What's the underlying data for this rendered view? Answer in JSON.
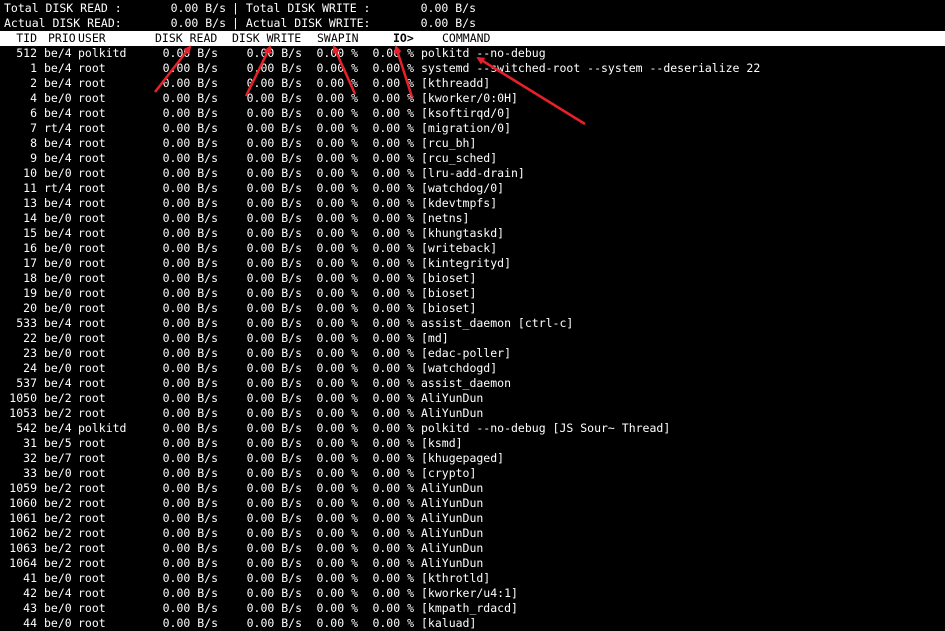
{
  "summary": {
    "total_read_label": "Total DISK READ :",
    "total_read_value": "0.00 B/s",
    "total_write_label": "| Total DISK WRITE :",
    "total_write_value": "0.00 B/s",
    "actual_read_label": "Actual DISK READ:",
    "actual_read_value": "0.00 B/s",
    "actual_write_label": "| Actual DISK WRITE:",
    "actual_write_value": "0.00 B/s"
  },
  "columns": {
    "tid": "TID",
    "prio": "PRIO",
    "user": "USER",
    "disk_read": "DISK READ",
    "disk_write": "DISK WRITE",
    "swapin": "SWAPIN",
    "io": "IO>",
    "command": "COMMAND"
  },
  "rows": [
    {
      "tid": "512",
      "prio": "be/4",
      "user": "polkitd",
      "read": "0.00 B/s",
      "write": "0.00 B/s",
      "swapin": "0.00 %",
      "io": "0.00 %",
      "command": "polkitd --no-debug"
    },
    {
      "tid": "1",
      "prio": "be/4",
      "user": "root",
      "read": "0.00 B/s",
      "write": "0.00 B/s",
      "swapin": "0.00 %",
      "io": "0.00 %",
      "command": "systemd --switched-root --system --deserialize 22"
    },
    {
      "tid": "2",
      "prio": "be/4",
      "user": "root",
      "read": "0.00 B/s",
      "write": "0.00 B/s",
      "swapin": "0.00 %",
      "io": "0.00 %",
      "command": "[kthreadd]"
    },
    {
      "tid": "4",
      "prio": "be/0",
      "user": "root",
      "read": "0.00 B/s",
      "write": "0.00 B/s",
      "swapin": "0.00 %",
      "io": "0.00 %",
      "command": "[kworker/0:0H]"
    },
    {
      "tid": "6",
      "prio": "be/4",
      "user": "root",
      "read": "0.00 B/s",
      "write": "0.00 B/s",
      "swapin": "0.00 %",
      "io": "0.00 %",
      "command": "[ksoftirqd/0]"
    },
    {
      "tid": "7",
      "prio": "rt/4",
      "user": "root",
      "read": "0.00 B/s",
      "write": "0.00 B/s",
      "swapin": "0.00 %",
      "io": "0.00 %",
      "command": "[migration/0]"
    },
    {
      "tid": "8",
      "prio": "be/4",
      "user": "root",
      "read": "0.00 B/s",
      "write": "0.00 B/s",
      "swapin": "0.00 %",
      "io": "0.00 %",
      "command": "[rcu_bh]"
    },
    {
      "tid": "9",
      "prio": "be/4",
      "user": "root",
      "read": "0.00 B/s",
      "write": "0.00 B/s",
      "swapin": "0.00 %",
      "io": "0.00 %",
      "command": "[rcu_sched]"
    },
    {
      "tid": "10",
      "prio": "be/0",
      "user": "root",
      "read": "0.00 B/s",
      "write": "0.00 B/s",
      "swapin": "0.00 %",
      "io": "0.00 %",
      "command": "[lru-add-drain]"
    },
    {
      "tid": "11",
      "prio": "rt/4",
      "user": "root",
      "read": "0.00 B/s",
      "write": "0.00 B/s",
      "swapin": "0.00 %",
      "io": "0.00 %",
      "command": "[watchdog/0]"
    },
    {
      "tid": "13",
      "prio": "be/4",
      "user": "root",
      "read": "0.00 B/s",
      "write": "0.00 B/s",
      "swapin": "0.00 %",
      "io": "0.00 %",
      "command": "[kdevtmpfs]"
    },
    {
      "tid": "14",
      "prio": "be/0",
      "user": "root",
      "read": "0.00 B/s",
      "write": "0.00 B/s",
      "swapin": "0.00 %",
      "io": "0.00 %",
      "command": "[netns]"
    },
    {
      "tid": "15",
      "prio": "be/4",
      "user": "root",
      "read": "0.00 B/s",
      "write": "0.00 B/s",
      "swapin": "0.00 %",
      "io": "0.00 %",
      "command": "[khungtaskd]"
    },
    {
      "tid": "16",
      "prio": "be/0",
      "user": "root",
      "read": "0.00 B/s",
      "write": "0.00 B/s",
      "swapin": "0.00 %",
      "io": "0.00 %",
      "command": "[writeback]"
    },
    {
      "tid": "17",
      "prio": "be/0",
      "user": "root",
      "read": "0.00 B/s",
      "write": "0.00 B/s",
      "swapin": "0.00 %",
      "io": "0.00 %",
      "command": "[kintegrityd]"
    },
    {
      "tid": "18",
      "prio": "be/0",
      "user": "root",
      "read": "0.00 B/s",
      "write": "0.00 B/s",
      "swapin": "0.00 %",
      "io": "0.00 %",
      "command": "[bioset]"
    },
    {
      "tid": "19",
      "prio": "be/0",
      "user": "root",
      "read": "0.00 B/s",
      "write": "0.00 B/s",
      "swapin": "0.00 %",
      "io": "0.00 %",
      "command": "[bioset]"
    },
    {
      "tid": "20",
      "prio": "be/0",
      "user": "root",
      "read": "0.00 B/s",
      "write": "0.00 B/s",
      "swapin": "0.00 %",
      "io": "0.00 %",
      "command": "[bioset]"
    },
    {
      "tid": "533",
      "prio": "be/4",
      "user": "root",
      "read": "0.00 B/s",
      "write": "0.00 B/s",
      "swapin": "0.00 %",
      "io": "0.00 %",
      "command": "assist_daemon [ctrl-c]"
    },
    {
      "tid": "22",
      "prio": "be/0",
      "user": "root",
      "read": "0.00 B/s",
      "write": "0.00 B/s",
      "swapin": "0.00 %",
      "io": "0.00 %",
      "command": "[md]"
    },
    {
      "tid": "23",
      "prio": "be/0",
      "user": "root",
      "read": "0.00 B/s",
      "write": "0.00 B/s",
      "swapin": "0.00 %",
      "io": "0.00 %",
      "command": "[edac-poller]"
    },
    {
      "tid": "24",
      "prio": "be/0",
      "user": "root",
      "read": "0.00 B/s",
      "write": "0.00 B/s",
      "swapin": "0.00 %",
      "io": "0.00 %",
      "command": "[watchdogd]"
    },
    {
      "tid": "537",
      "prio": "be/4",
      "user": "root",
      "read": "0.00 B/s",
      "write": "0.00 B/s",
      "swapin": "0.00 %",
      "io": "0.00 %",
      "command": "assist_daemon"
    },
    {
      "tid": "1050",
      "prio": "be/2",
      "user": "root",
      "read": "0.00 B/s",
      "write": "0.00 B/s",
      "swapin": "0.00 %",
      "io": "0.00 %",
      "command": "AliYunDun"
    },
    {
      "tid": "1053",
      "prio": "be/2",
      "user": "root",
      "read": "0.00 B/s",
      "write": "0.00 B/s",
      "swapin": "0.00 %",
      "io": "0.00 %",
      "command": "AliYunDun"
    },
    {
      "tid": "542",
      "prio": "be/4",
      "user": "polkitd",
      "read": "0.00 B/s",
      "write": "0.00 B/s",
      "swapin": "0.00 %",
      "io": "0.00 %",
      "command": "polkitd --no-debug [JS Sour~ Thread]"
    },
    {
      "tid": "31",
      "prio": "be/5",
      "user": "root",
      "read": "0.00 B/s",
      "write": "0.00 B/s",
      "swapin": "0.00 %",
      "io": "0.00 %",
      "command": "[ksmd]"
    },
    {
      "tid": "32",
      "prio": "be/7",
      "user": "root",
      "read": "0.00 B/s",
      "write": "0.00 B/s",
      "swapin": "0.00 %",
      "io": "0.00 %",
      "command": "[khugepaged]"
    },
    {
      "tid": "33",
      "prio": "be/0",
      "user": "root",
      "read": "0.00 B/s",
      "write": "0.00 B/s",
      "swapin": "0.00 %",
      "io": "0.00 %",
      "command": "[crypto]"
    },
    {
      "tid": "1059",
      "prio": "be/2",
      "user": "root",
      "read": "0.00 B/s",
      "write": "0.00 B/s",
      "swapin": "0.00 %",
      "io": "0.00 %",
      "command": "AliYunDun"
    },
    {
      "tid": "1060",
      "prio": "be/2",
      "user": "root",
      "read": "0.00 B/s",
      "write": "0.00 B/s",
      "swapin": "0.00 %",
      "io": "0.00 %",
      "command": "AliYunDun"
    },
    {
      "tid": "1061",
      "prio": "be/2",
      "user": "root",
      "read": "0.00 B/s",
      "write": "0.00 B/s",
      "swapin": "0.00 %",
      "io": "0.00 %",
      "command": "AliYunDun"
    },
    {
      "tid": "1062",
      "prio": "be/2",
      "user": "root",
      "read": "0.00 B/s",
      "write": "0.00 B/s",
      "swapin": "0.00 %",
      "io": "0.00 %",
      "command": "AliYunDun"
    },
    {
      "tid": "1063",
      "prio": "be/2",
      "user": "root",
      "read": "0.00 B/s",
      "write": "0.00 B/s",
      "swapin": "0.00 %",
      "io": "0.00 %",
      "command": "AliYunDun"
    },
    {
      "tid": "1064",
      "prio": "be/2",
      "user": "root",
      "read": "0.00 B/s",
      "write": "0.00 B/s",
      "swapin": "0.00 %",
      "io": "0.00 %",
      "command": "AliYunDun"
    },
    {
      "tid": "41",
      "prio": "be/0",
      "user": "root",
      "read": "0.00 B/s",
      "write": "0.00 B/s",
      "swapin": "0.00 %",
      "io": "0.00 %",
      "command": "[kthrotld]"
    },
    {
      "tid": "42",
      "prio": "be/4",
      "user": "root",
      "read": "0.00 B/s",
      "write": "0.00 B/s",
      "swapin": "0.00 %",
      "io": "0.00 %",
      "command": "[kworker/u4:1]"
    },
    {
      "tid": "43",
      "prio": "be/0",
      "user": "root",
      "read": "0.00 B/s",
      "write": "0.00 B/s",
      "swapin": "0.00 %",
      "io": "0.00 %",
      "command": "[kmpath_rdacd]"
    },
    {
      "tid": "44",
      "prio": "be/0",
      "user": "root",
      "read": "0.00 B/s",
      "write": "0.00 B/s",
      "swapin": "0.00 %",
      "io": "0.00 %",
      "command": "[kaluad]"
    }
  ],
  "annotation_color": "#e8202a",
  "background_color": "#000000",
  "text_color": "#ffffff"
}
